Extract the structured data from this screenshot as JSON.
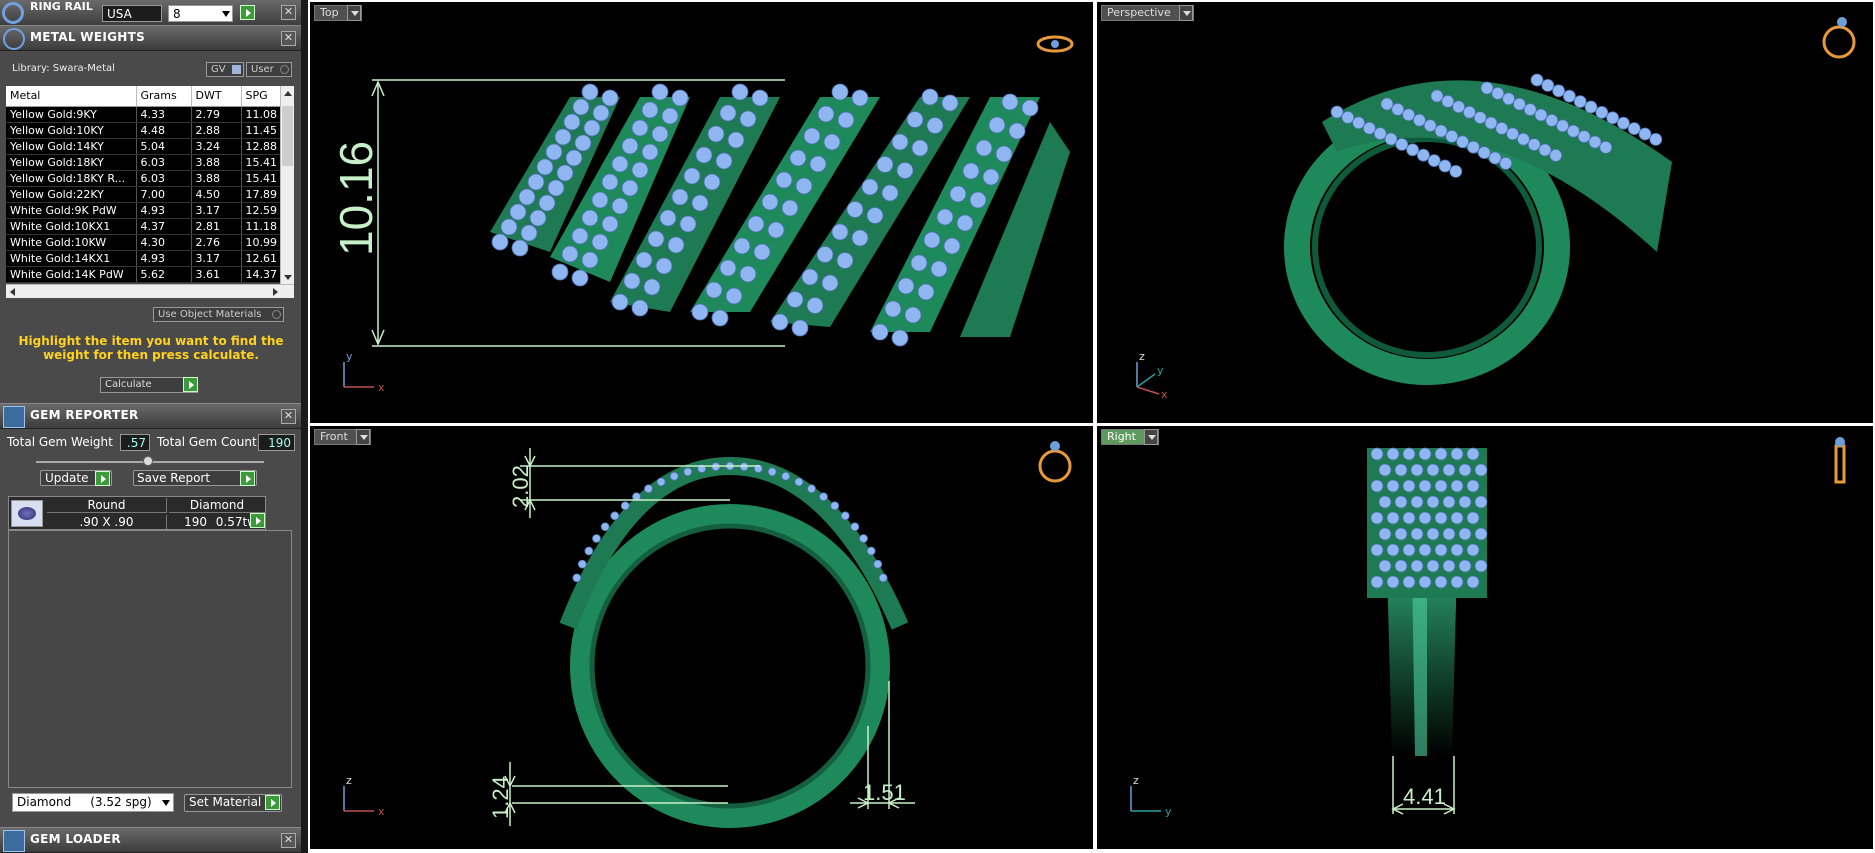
{
  "left_panel": {
    "ring_rail": {
      "title": "RING RAIL",
      "size_system": "USA",
      "size_value": "8"
    },
    "metal_weights": {
      "title": "METAL WEIGHTS",
      "library_label": "Library: Swara-Metal",
      "gv_label": "GV",
      "user_label": "User",
      "columns": [
        "Metal",
        "Grams",
        "DWT",
        "SPG"
      ],
      "rows": [
        [
          "Yellow Gold:9KY",
          "4.33",
          "2.79",
          "11.08"
        ],
        [
          "Yellow Gold:10KY",
          "4.48",
          "2.88",
          "11.45"
        ],
        [
          "Yellow Gold:14KY",
          "5.04",
          "3.24",
          "12.88"
        ],
        [
          "Yellow Gold:18KY",
          "6.03",
          "3.88",
          "15.41"
        ],
        [
          "Yellow Gold:18KY R...",
          "6.03",
          "3.88",
          "15.41"
        ],
        [
          "Yellow Gold:22KY",
          "7.00",
          "4.50",
          "17.89"
        ],
        [
          "White Gold:9K PdW",
          "4.93",
          "3.17",
          "12.59"
        ],
        [
          "White Gold:10KX1",
          "4.37",
          "2.81",
          "11.18"
        ],
        [
          "White Gold:10KW",
          "4.30",
          "2.76",
          "10.99"
        ],
        [
          "White Gold:14KX1",
          "4.93",
          "3.17",
          "12.61"
        ],
        [
          "White Gold:14K PdW",
          "5.62",
          "3.61",
          "14.37"
        ]
      ],
      "use_object_materials": "Use Object Materials",
      "hint": "Highlight the item you want to find the weight for then press calculate.",
      "calculate_label": "Calculate"
    },
    "gem_reporter": {
      "title": "GEM REPORTER",
      "total_weight_label": "Total Gem Weight",
      "total_weight_value": ".57",
      "total_count_label": "Total Gem Count",
      "total_count_value": "190",
      "update_label": "Update",
      "save_report_label": "Save Report",
      "gem": {
        "shape": "Round",
        "type": "Diamond",
        "size": ".90 X .90",
        "count": "190",
        "tw": "0.57tw"
      },
      "material_select": "Diamond     (3.52 spg)",
      "set_material_label": "Set Material"
    },
    "gem_loader": {
      "title": "GEM LOADER"
    }
  },
  "viewports": {
    "top": {
      "label": "Top",
      "dimension": "10.16",
      "axis_a": "y",
      "axis_b": "x"
    },
    "perspective": {
      "label": "Perspective",
      "axis_a": "z",
      "axis_b": "y",
      "axis_c": "x"
    },
    "front": {
      "label": "Front",
      "dim_top": "2.02",
      "dim_bottom": "1.24",
      "dim_right": "1.51",
      "axis_a": "z",
      "axis_b": "x"
    },
    "right": {
      "label": "Right",
      "dim_bottom": "4.41",
      "axis_a": "z",
      "axis_b": "y"
    }
  },
  "colors": {
    "metal": "#1e8a5c",
    "gem": "#8fb6f0",
    "dimension": "#c8f0c8",
    "hint": "#ffd21f",
    "accent_green": "#3c9a3c"
  }
}
